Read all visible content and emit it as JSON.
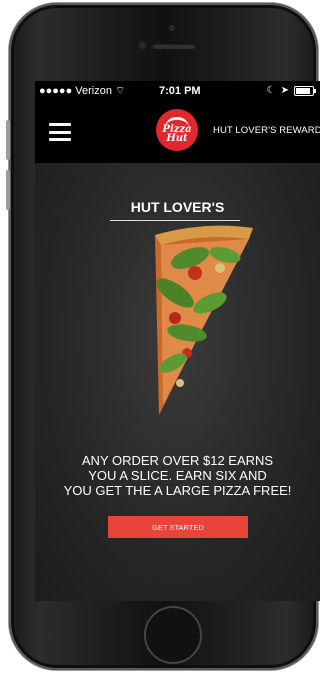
{
  "status_bar": {
    "carrier": "●●●●● Verizon",
    "time": "7:01 PM"
  },
  "navbar": {
    "menu_icon": "hamburger-icon",
    "logo_text_line1": "Pizza",
    "logo_text_line2": "Hut",
    "rewards_link": "HUT LOVER'S REWARDS"
  },
  "main": {
    "heading": "HUT LOVER'S",
    "promo_line1": "ANY ORDER OVER $12 EARNS",
    "promo_line2": "YOU A SLICE. EARN SIX AND",
    "promo_line3": "YOU GET THE A LARGE PIZZA FREE!",
    "cta_label": "GET STARTED"
  },
  "colors": {
    "brand_red": "#e3272c",
    "cta_red": "#e8443a",
    "background": "#262626"
  }
}
